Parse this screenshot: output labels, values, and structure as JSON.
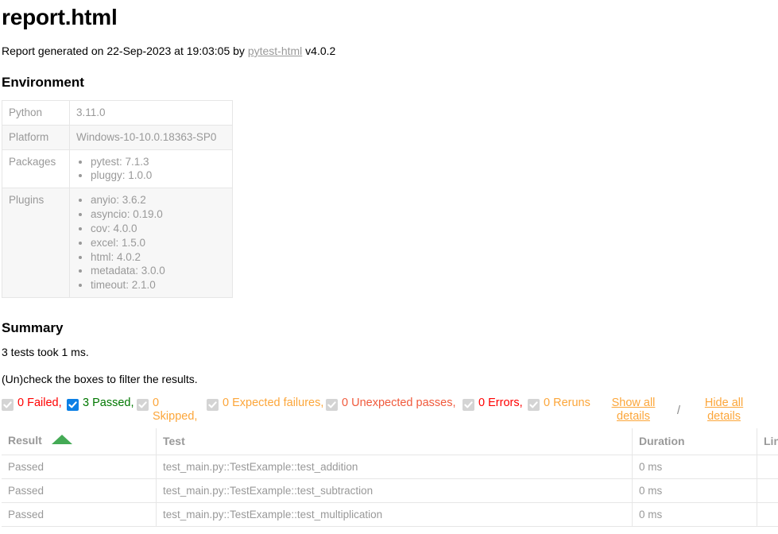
{
  "report": {
    "title": "report.html",
    "generated_prefix": "Report generated on ",
    "date": "22-Sep-2023",
    "at_word": " at ",
    "time": "19:03:05",
    "by_word": " by ",
    "generator_link": "pytest-html",
    "version": " v4.0.2"
  },
  "environment": {
    "heading": "Environment",
    "rows": [
      {
        "key": "Python",
        "value": "3.11.0",
        "type": "text"
      },
      {
        "key": "Platform",
        "value": "Windows-10-10.0.18363-SP0",
        "type": "text"
      },
      {
        "key": "Packages",
        "type": "list",
        "items": [
          "pytest: 7.1.3",
          "pluggy: 1.0.0"
        ]
      },
      {
        "key": "Plugins",
        "type": "list",
        "items": [
          "anyio: 3.6.2",
          "asyncio: 0.19.0",
          "cov: 4.0.0",
          "excel: 1.5.0",
          "html: 4.0.2",
          "metadata: 3.0.0",
          "timeout: 2.1.0"
        ]
      }
    ]
  },
  "summary": {
    "heading": "Summary",
    "tests_line": "3 tests took 1 ms.",
    "filter_hint": "(Un)check the boxes to filter the results.",
    "filters": [
      {
        "count": "0",
        "label": "Failed,",
        "checked": false,
        "color": "#ff0000"
      },
      {
        "count": "3",
        "label": "Passed,",
        "checked": true,
        "color": "#007700"
      },
      {
        "count": "0",
        "label": "Skipped,",
        "checked": false,
        "color": "#fca63a"
      },
      {
        "count": "0",
        "label": "Expected failures,",
        "checked": false,
        "color": "#fca63a"
      },
      {
        "count": "0",
        "label": "Unexpected passes,",
        "checked": false,
        "color": "#f05a3c"
      },
      {
        "count": "0",
        "label": "Errors,",
        "checked": false,
        "color": "#ff0000"
      },
      {
        "count": "0",
        "label": "Reruns",
        "checked": false,
        "color": "#fca63a"
      }
    ],
    "show_all_details": "Show all details",
    "separator": "/",
    "hide_all_details": "Hide all details"
  },
  "results": {
    "columns": [
      "Result",
      "Test",
      "Duration",
      "Links"
    ],
    "sorted_column": "Result",
    "sort_direction": "ascending",
    "sort_arrow_color": "#44aa55",
    "rows": [
      {
        "result": "Passed",
        "test": "test_main.py::TestExample::test_addition",
        "duration": "0 ms",
        "links": ""
      },
      {
        "result": "Passed",
        "test": "test_main.py::TestExample::test_subtraction",
        "duration": "0 ms",
        "links": ""
      },
      {
        "result": "Passed",
        "test": "test_main.py::TestExample::test_multiplication",
        "duration": "0 ms",
        "links": ""
      }
    ]
  }
}
